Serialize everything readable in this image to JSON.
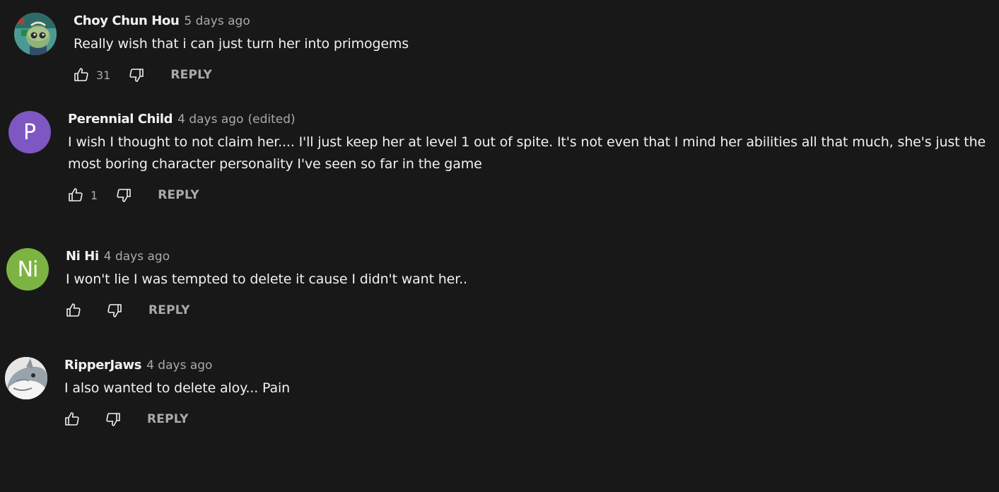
{
  "comments": [
    {
      "author": "Choy Chun Hou",
      "time": "5 days ago",
      "edited": "",
      "text_lines": [
        "Really wish that i can just turn her into primogems"
      ],
      "likes": "31",
      "reply_label": "REPLY",
      "avatar": {
        "type": "image",
        "icon": "character-avatar-icon",
        "color": "#3e8f8a"
      }
    },
    {
      "author": "Perennial Child",
      "time": "4 days ago",
      "edited": "(edited)",
      "text_lines": [
        "I wish I thought to not claim her.... I'll just keep her at level 1 out of spite. It's not even that I mind her abilities all that much, she's just the",
        "most boring character personality I've seen so far in the game"
      ],
      "likes": "1",
      "reply_label": "REPLY",
      "avatar": {
        "type": "letter",
        "letter": "P",
        "color": "#7e57c2"
      }
    },
    {
      "author": "Ni Hi",
      "time": "4 days ago",
      "edited": "",
      "text_lines": [
        "I won't lie I was tempted to delete it cause I didn't want her.."
      ],
      "likes": "",
      "reply_label": "REPLY",
      "avatar": {
        "type": "letter",
        "letter": "Ni",
        "color": "#7cb342"
      }
    },
    {
      "author": "RipperJaws",
      "time": "4 days ago",
      "edited": "",
      "text_lines": [
        "I also wanted to delete aloy... Pain"
      ],
      "likes": "",
      "reply_label": "REPLY",
      "avatar": {
        "type": "image",
        "icon": "shark-avatar-icon",
        "color": "#d9d9d9"
      }
    }
  ],
  "icons": {
    "like": "thumbs-up-icon",
    "dislike": "thumbs-down-icon"
  },
  "colors": {
    "background": "#181818",
    "primary_text": "#f1f1f1",
    "secondary_text": "#aaaaaa"
  }
}
